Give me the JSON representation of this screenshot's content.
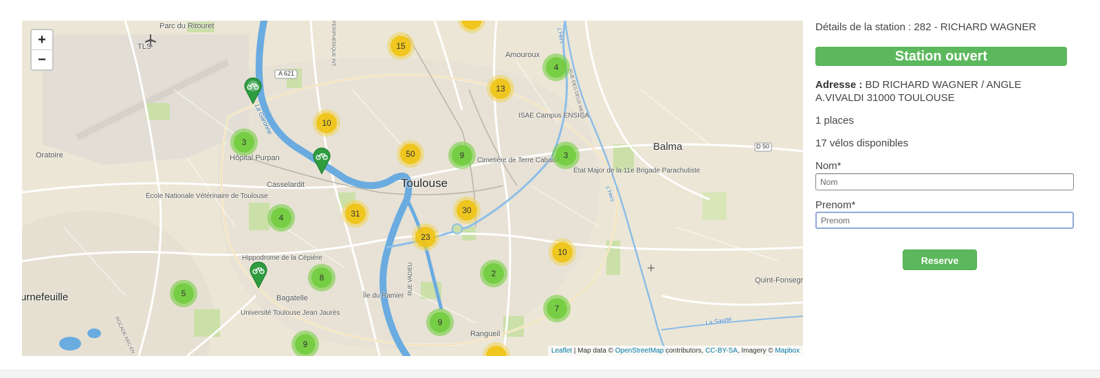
{
  "map": {
    "zoom_in_label": "+",
    "zoom_out_label": "−",
    "attribution": {
      "leaflet": "Leaflet",
      "sep1": " | Map data © ",
      "osm": "OpenStreetMap",
      "sep2": " contributors, ",
      "license": "CC-BY-SA",
      "sep3": ", Imagery © ",
      "mapbox": "Mapbox"
    },
    "places": {
      "parc_ritouret": "Parc du Ritouret",
      "tls": "TLS",
      "a621": "A 621",
      "amouroux": "Amouroux",
      "isae": "ISAE Campus ENSICA",
      "oratoire": "Oratoire",
      "hopital": "Hôpital Purpan",
      "casselardit": "Casselardit",
      "toulouse": "Toulouse",
      "cimetiere": "Cimetière de Terre Cabade",
      "etat_major": "État Major de la 11e Brigade Parachutiste",
      "balma": "Balma",
      "d50": "D 50",
      "ecole_veto": "École Nationale Vétérinaire de Toulouse",
      "hippodrome": "Hippodrome de la Cépière",
      "bagatelle": "Bagatelle",
      "ile_ramier": "Île du Ramier",
      "rue_vadieu": "RUE VADIEU",
      "tournefeuille": "urnefeuille",
      "universite": "Université Toulouse Jean Jaurès",
      "rangueil": "Rangueil",
      "quint": "Quint-Fonsegrives",
      "la_saune": "La Saune",
      "garonne": "La Garonne",
      "peripherique": "PÉRIPHÉRIQUE INT.",
      "rocade": "ROCADE ARC-EN",
      "lhers1": "L'Hers",
      "lhers2": "L'Hers",
      "rue_canal": "RUE DES DEUX MERS"
    },
    "clusters": [
      {
        "id": "c15",
        "count": "15",
        "color": "yellow"
      },
      {
        "id": "c4a",
        "count": "4",
        "color": "green"
      },
      {
        "id": "c13",
        "count": "13",
        "color": "yellow"
      },
      {
        "id": "c10a",
        "count": "10",
        "color": "yellow"
      },
      {
        "id": "c3a",
        "count": "3",
        "color": "green"
      },
      {
        "id": "c50",
        "count": "50",
        "color": "yellow"
      },
      {
        "id": "c9a",
        "count": "9",
        "color": "green"
      },
      {
        "id": "c3b",
        "count": "3",
        "color": "green"
      },
      {
        "id": "c4b",
        "count": "4",
        "color": "green"
      },
      {
        "id": "c31",
        "count": "31",
        "color": "yellow"
      },
      {
        "id": "c30",
        "count": "30",
        "color": "yellow"
      },
      {
        "id": "c23",
        "count": "23",
        "color": "yellow"
      },
      {
        "id": "c10b",
        "count": "10",
        "color": "yellow"
      },
      {
        "id": "c5",
        "count": "5",
        "color": "green"
      },
      {
        "id": "c8",
        "count": "8",
        "color": "green"
      },
      {
        "id": "c2",
        "count": "2",
        "color": "green"
      },
      {
        "id": "c7",
        "count": "7",
        "color": "green"
      },
      {
        "id": "c9b",
        "count": "9",
        "color": "green"
      },
      {
        "id": "c9c",
        "count": "9",
        "color": "green"
      }
    ]
  },
  "panel": {
    "station_title": "Détails de la station : 282 - RICHARD WAGNER",
    "status": "Station ouvert",
    "address_label": "Adresse :",
    "address_value": " BD RICHARD WAGNER / ANGLE A.VIVALDI 31000 TOULOUSE",
    "places": "1 places",
    "bikes": "17 vélos disponibles",
    "nom_label": "Nom*",
    "nom_placeholder": "Nom",
    "prenom_label": "Prenom*",
    "prenom_placeholder": "Prenom",
    "reserve_label": "Reserve"
  },
  "colors": {
    "status_green": "#5cb85c",
    "cluster_green": "#6ecc39",
    "cluster_yellow": "#f0c20c",
    "water": "#6aabe0",
    "marker_green": "#2e9c3f"
  }
}
